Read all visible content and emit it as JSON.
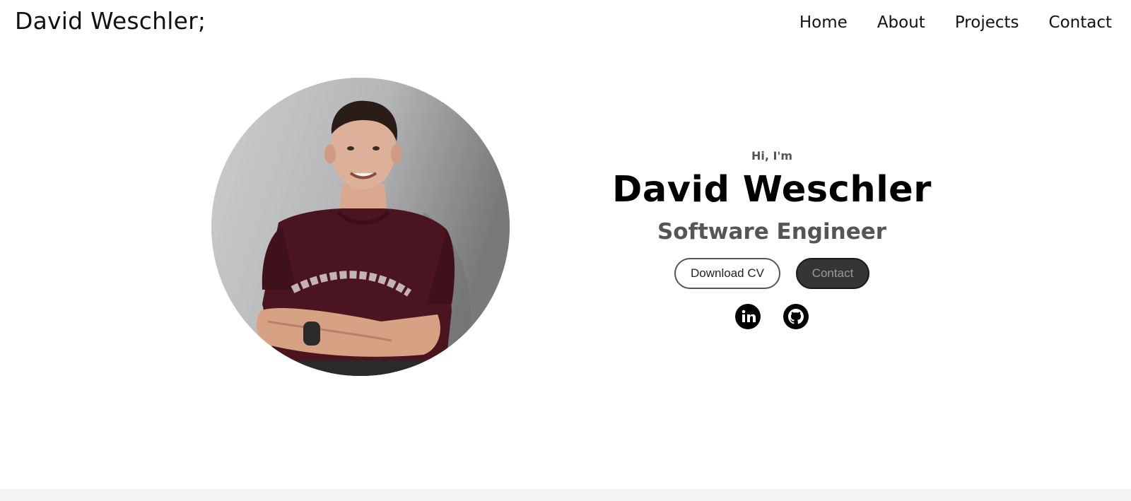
{
  "nav": {
    "logo": "David Weschler;",
    "links": [
      "Home",
      "About",
      "Projects",
      "Contact"
    ]
  },
  "hero": {
    "greeting": "Hi, I'm",
    "name": "David Weschler",
    "role": "Software Engineer",
    "buttons": {
      "download_cv": "Download CV",
      "contact": "Contact"
    },
    "socials": [
      "linkedin-icon",
      "github-icon"
    ],
    "profile_image": "profile-photo"
  },
  "colors": {
    "text_primary": "#000000",
    "text_secondary": "#555555",
    "button_dark": "#353535",
    "background": "#ffffff"
  }
}
